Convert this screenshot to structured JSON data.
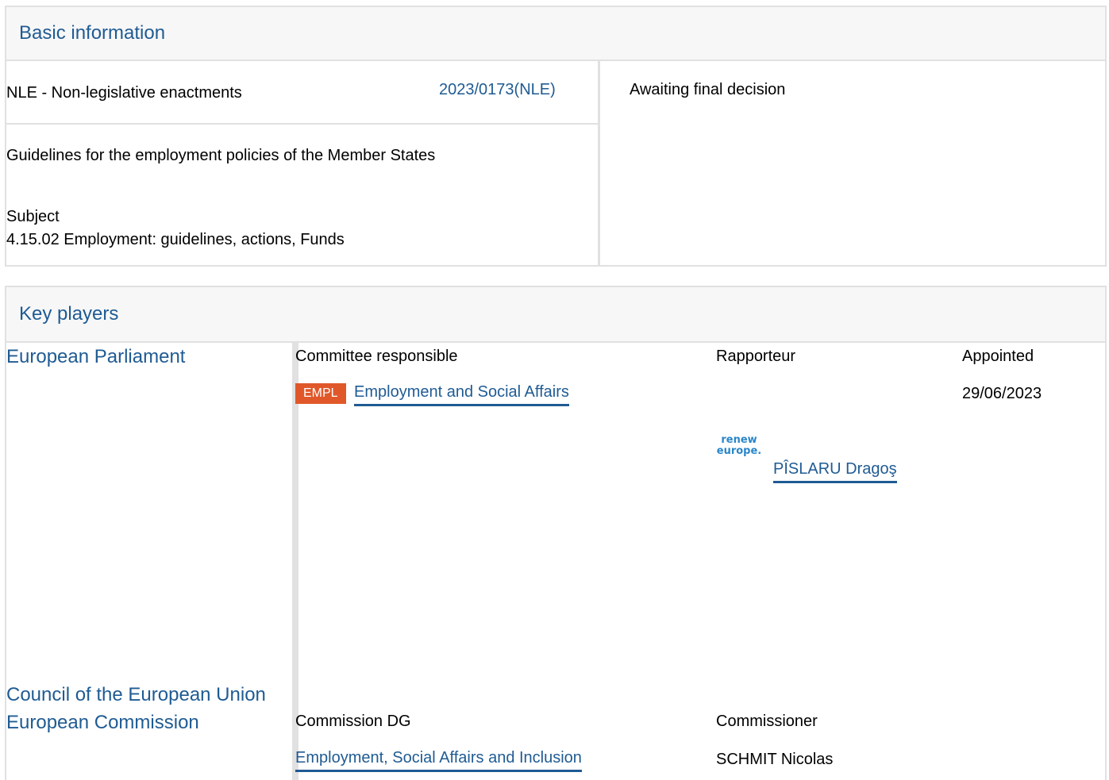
{
  "basic_information": {
    "title": "Basic information",
    "procedure_type": "NLE - Non-legislative enactments",
    "procedure_ref": "2023/0173(NLE)",
    "status": "Awaiting final decision",
    "description": "Guidelines for the employment policies of the Member States",
    "subject_label": "Subject",
    "subject_value": "4.15.02 Employment: guidelines, actions, Funds"
  },
  "key_players": {
    "title": "Key players",
    "parliament": {
      "name": "European Parliament",
      "col_committee": "Committee responsible",
      "col_rapporteur": "Rapporteur",
      "col_appointed": "Appointed",
      "committee_badge": "EMPL",
      "committee_name": "Employment and Social Affairs",
      "appointed_date": "29/06/2023",
      "group_logo_line1": "renew",
      "group_logo_line2": "europe.",
      "rapporteur_name": "PÎSLARU Dragoş"
    },
    "council": {
      "name": "Council of the European Union"
    },
    "commission": {
      "name": "European Commission",
      "col_dg": "Commission DG",
      "col_commissioner": "Commissioner",
      "dg_name": "Employment, Social Affairs and Inclusion",
      "commissioner_name": "SCHMIT Nicolas"
    }
  }
}
